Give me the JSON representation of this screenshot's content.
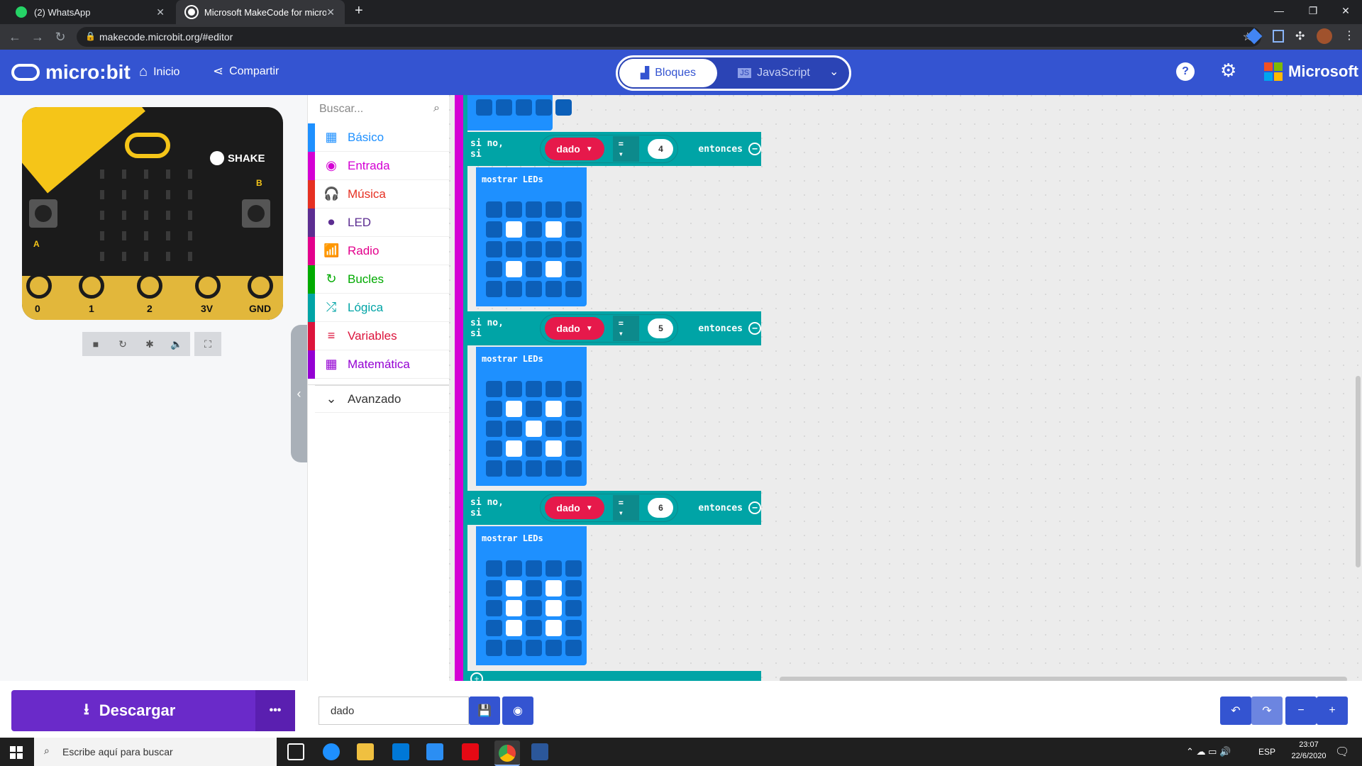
{
  "browser": {
    "tabs": [
      {
        "label": "(2) WhatsApp",
        "close": "✕"
      },
      {
        "label": "Microsoft MakeCode for micro:bi",
        "close": "✕"
      }
    ],
    "new_tab": "+",
    "url": "makecode.microbit.org/#editor",
    "window_controls": {
      "minimize": "—",
      "restore": "❐",
      "close": "✕"
    }
  },
  "header": {
    "logo": "micro:bit",
    "home": "Inicio",
    "share": "Compartir",
    "blocks_tab": "Bloques",
    "js_tab": "JavaScript",
    "brand": "Microsoft",
    "help_icon": "?",
    "settings_icon": "⚙"
  },
  "simulator": {
    "shake": "SHAKE",
    "button_a": "A",
    "button_b": "B",
    "pins": [
      "0",
      "1",
      "2",
      "3V",
      "GND"
    ]
  },
  "toolbox": {
    "search_placeholder": "Buscar...",
    "categories": [
      {
        "label": "Básico",
        "color": "#1e90ff",
        "icon": "▦"
      },
      {
        "label": "Entrada",
        "color": "#d400d4",
        "icon": "◉"
      },
      {
        "label": "Música",
        "color": "#e63022",
        "icon": "🎧"
      },
      {
        "label": "LED",
        "color": "#5c2d91",
        "icon": "⏺"
      },
      {
        "label": "Radio",
        "color": "#e3008c",
        "icon": "📶"
      },
      {
        "label": "Bucles",
        "color": "#00aa00",
        "icon": "↻"
      },
      {
        "label": "Lógica",
        "color": "#00a4a6",
        "icon": "⤮"
      },
      {
        "label": "Variables",
        "color": "#dc143c",
        "icon": "≡"
      },
      {
        "label": "Matemática",
        "color": "#9400d3",
        "icon": "▦"
      }
    ],
    "advanced": "Avanzado"
  },
  "blocks": {
    "else_if": "si no, si",
    "variable": "dado",
    "operator": "=",
    "then": "entonces",
    "show_leds": "mostrar LEDs",
    "branches": [
      {
        "value": "4",
        "leds": [
          0,
          0,
          0,
          0,
          0,
          0,
          1,
          0,
          1,
          0,
          0,
          0,
          0,
          0,
          0,
          0,
          1,
          0,
          1,
          0,
          0,
          0,
          0,
          0,
          0
        ]
      },
      {
        "value": "5",
        "leds": [
          0,
          0,
          0,
          0,
          0,
          0,
          1,
          0,
          1,
          0,
          0,
          0,
          1,
          0,
          0,
          0,
          1,
          0,
          1,
          0,
          0,
          0,
          0,
          0,
          0
        ]
      },
      {
        "value": "6",
        "leds": [
          0,
          0,
          0,
          0,
          0,
          0,
          1,
          0,
          1,
          0,
          0,
          1,
          0,
          1,
          0,
          0,
          1,
          0,
          1,
          0,
          0,
          0,
          0,
          0,
          0
        ]
      }
    ]
  },
  "footer": {
    "download": "Descargar",
    "more": "•••",
    "project_name": "dado"
  },
  "taskbar": {
    "search": "Escribe aquí para buscar",
    "lang": "ESP",
    "time": "23:07",
    "date": "22/6/2020"
  }
}
